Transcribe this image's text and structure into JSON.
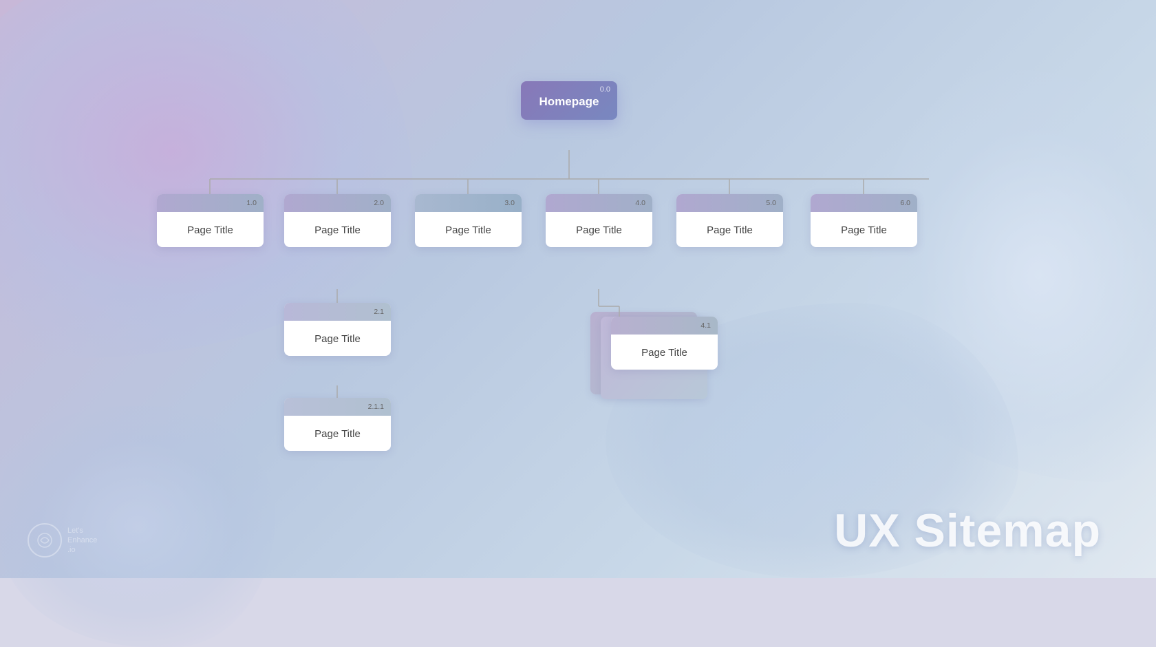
{
  "background": {
    "gradient_start": "#c8b8d8",
    "gradient_end": "#e0e8f0"
  },
  "title": "UX Sitemap",
  "logo": {
    "text_line1": "Let's",
    "text_line2": "Enhance",
    "text_line3": ".io"
  },
  "nodes": {
    "root": {
      "id": "0.0",
      "label": "Homepage"
    },
    "level1": [
      {
        "id": "1.0",
        "label": "Page Title"
      },
      {
        "id": "2.0",
        "label": "Page Title"
      },
      {
        "id": "3.0",
        "label": "Page Title"
      },
      {
        "id": "4.0",
        "label": "Page Title"
      },
      {
        "id": "5.0",
        "label": "Page Title"
      },
      {
        "id": "6.0",
        "label": "Page Title"
      }
    ],
    "level2": [
      {
        "id": "2.1",
        "label": "Page Title",
        "parent": "2.0"
      },
      {
        "id": "4.1",
        "label": "Page Title",
        "parent": "4.0",
        "stacked": true
      }
    ],
    "level3": [
      {
        "id": "2.1.1",
        "label": "Page Title",
        "parent": "2.1"
      }
    ]
  },
  "connections": {
    "root_to_level1": true,
    "level1_children": true
  }
}
